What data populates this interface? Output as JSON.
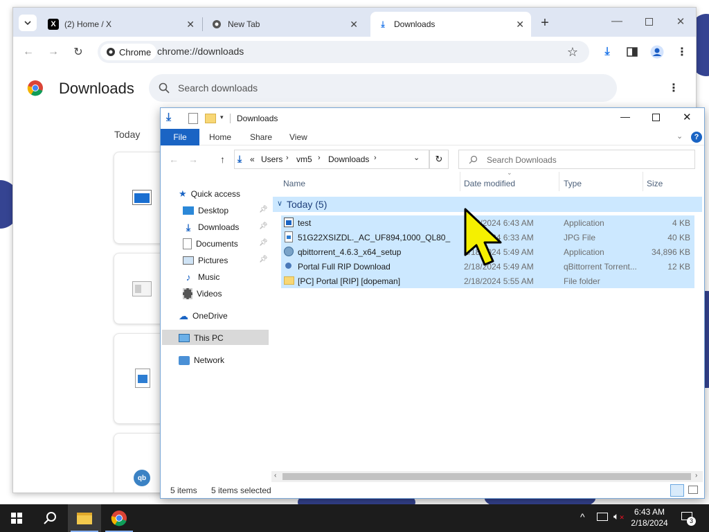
{
  "chrome": {
    "tabs": [
      {
        "title": "(2) Home / X"
      },
      {
        "title": "New Tab"
      },
      {
        "title": "Downloads"
      }
    ],
    "new_tab_symbol": "+",
    "omnibox": {
      "chip_label": "Chrome",
      "url": "chrome://downloads"
    },
    "page_title": "Downloads",
    "search_placeholder": "Search downloads",
    "date_group": "Today"
  },
  "explorer": {
    "title": "Downloads",
    "ribbon_tabs": [
      "File",
      "Home",
      "Share",
      "View"
    ],
    "breadcrumb": [
      "Users",
      "vm5",
      "Downloads"
    ],
    "breadcrumb_prefix": "«",
    "search_placeholder": "Search Downloads",
    "nav": {
      "quick_access": "Quick access",
      "items": [
        "Desktop",
        "Downloads",
        "Documents",
        "Pictures",
        "Music",
        "Videos"
      ],
      "onedrive": "OneDrive",
      "this_pc": "This PC",
      "network": "Network"
    },
    "columns": {
      "name": "Name",
      "date": "Date modified",
      "type": "Type",
      "size": "Size"
    },
    "group_label": "Today (5)",
    "files": [
      {
        "name": "test",
        "date": "2/18/2024 6:43 AM",
        "type": "Application",
        "size": "4 KB"
      },
      {
        "name": "51G22XSIZDL._AC_UF894,1000_QL80_",
        "date": "2/18/2024 6:33 AM",
        "type": "JPG File",
        "size": "40 KB"
      },
      {
        "name": "qbittorrent_4.6.3_x64_setup",
        "date": "2/18/2024 5:49 AM",
        "type": "Application",
        "size": "34,896 KB"
      },
      {
        "name": "Portal Full RIP Download",
        "date": "2/18/2024 5:49 AM",
        "type": "qBittorrent Torrent...",
        "size": "12 KB"
      },
      {
        "name": "[PC] Portal [RIP] [dopeman]",
        "date": "2/18/2024 5:55 AM",
        "type": "File folder",
        "size": ""
      }
    ],
    "status": {
      "items": "5 items",
      "selected": "5 items selected"
    }
  },
  "taskbar": {
    "time": "6:43 AM",
    "date": "2/18/2024",
    "notification_count": "3"
  },
  "colors": {
    "chrome_tabstrip": "#dfe6f3",
    "explorer_accent": "#1a64c4",
    "selection": "#cce8ff",
    "taskbar": "#1c1c1c"
  }
}
